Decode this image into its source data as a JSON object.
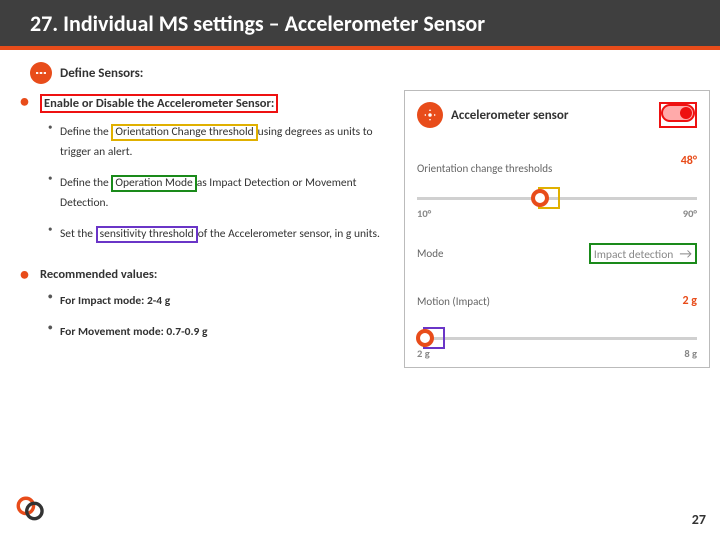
{
  "header": {
    "title": "27. Individual MS settings – Accelerometer Sensor"
  },
  "step": {
    "label": "Define Sensors:"
  },
  "left": {
    "b1_pre": "Enable or Disable the Accelerometer  Sensor:",
    "s1a": "Define the ",
    "s1b": "Orientation Change threshold ",
    "s1c": "using degrees as units to trigger an alert.",
    "s2a": "Define the ",
    "s2b": "Operation Mode ",
    "s2c": "as Impact Detection or Movement Detection.",
    "s3a": "Set the ",
    "s3b": "sensitivity threshold ",
    "s3c": "of the Accelerometer sensor, in g units.",
    "b2": "Recommended values:",
    "r1": "For Impact mode:  2-4  g",
    "r2": "For Movement mode:  0.7-0.9  g"
  },
  "phone": {
    "title": "Accelerometer sensor",
    "sec1": "Orientation change thresholds",
    "sec1_val": "48°",
    "s1_min": "10°",
    "s1_max": "90°",
    "mode_lbl": "Mode",
    "mode_val": "Impact detection",
    "sec2": "Motion (Impact)",
    "sec2_val": "2 g",
    "s2_min": "2 g",
    "s2_max": "8 g"
  },
  "footer": {
    "page": "27"
  }
}
